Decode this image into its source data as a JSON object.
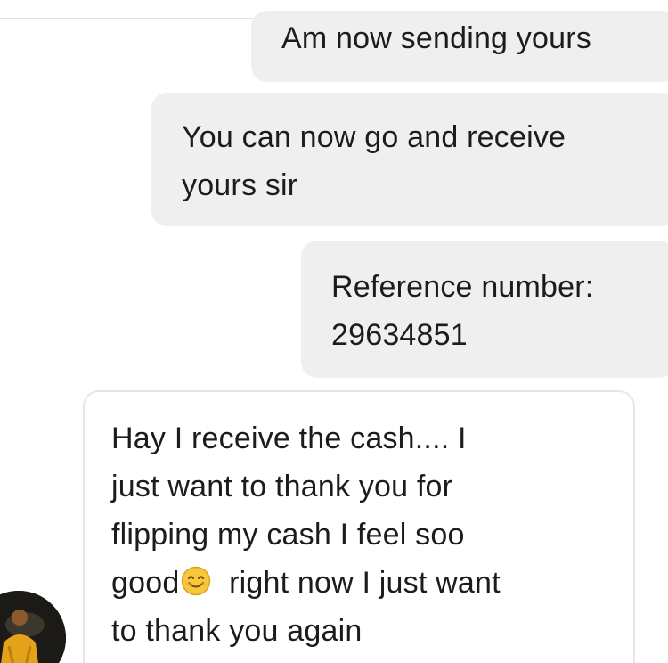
{
  "conversation": {
    "messages": [
      {
        "direction": "sent",
        "lines": [
          "Am now sending yours"
        ]
      },
      {
        "direction": "sent",
        "lines": [
          "You can now go and receive",
          "yours sir"
        ]
      },
      {
        "direction": "sent",
        "lines": [
          "Reference number:",
          "29634851"
        ]
      },
      {
        "direction": "received",
        "lines": [
          "Hay I receive the cash.... I",
          "just want to thank you for",
          "flipping my cash I feel soo",
          "good",
          " right now I just want",
          "to thank you again"
        ],
        "emoji": "smiling-face-emoji"
      }
    ]
  },
  "sender": {
    "avatar_icon": "person-avatar"
  },
  "colors": {
    "sent_bubble": "#efefef",
    "received_bubble": "#ffffff",
    "received_border": "#e6e6e6",
    "text": "#1c1c1c",
    "emoji_fill": "#f7c83a"
  }
}
